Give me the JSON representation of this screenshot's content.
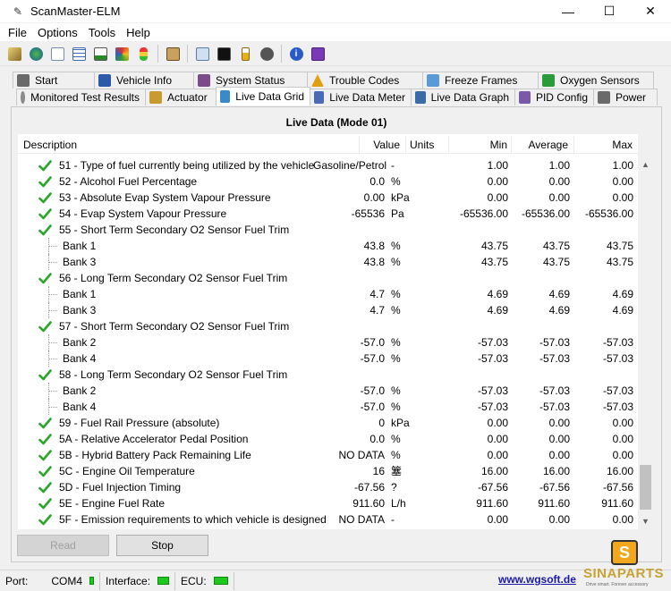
{
  "window": {
    "title": "ScanMaster-ELM",
    "controls": {
      "minimize": "—",
      "maximize": "☐",
      "close": "✕"
    }
  },
  "menu": [
    "File",
    "Options",
    "Tools",
    "Help"
  ],
  "toolbar_icons": [
    "connect-icon",
    "globe-icon",
    "document-icon",
    "grid-icon",
    "chart-icon",
    "gauge-icon",
    "stoplight-icon",
    "clipboard-icon",
    "terminal-chat-icon",
    "console-icon",
    "battery-icon",
    "stop-icon",
    "info-icon",
    "exit-icon"
  ],
  "tabs_row1": [
    {
      "label": "Start",
      "icon": "start-icon",
      "color": "#6a6a6a"
    },
    {
      "label": "Vehicle Info",
      "icon": "info-icon",
      "color": "#2d5aa8"
    },
    {
      "label": "System Status",
      "icon": "status-icon",
      "color": "#7a4a8a"
    },
    {
      "label": "Trouble Codes",
      "icon": "warning-icon",
      "color": "#e0a010"
    },
    {
      "label": "Freeze Frames",
      "icon": "snowflake-icon",
      "color": "#5a9ad8"
    },
    {
      "label": "Oxygen Sensors",
      "icon": "sensor-icon",
      "color": "#2a9a3a"
    }
  ],
  "tabs_row2": [
    {
      "label": "Monitored Test Results",
      "icon": "gear-icon",
      "color": "#8a8a8a"
    },
    {
      "label": "Actuator",
      "icon": "actuator-icon",
      "color": "#c89a30"
    },
    {
      "label": "Live Data Grid",
      "icon": "grid-icon",
      "color": "#3a8ac8",
      "active": true
    },
    {
      "label": "Live Data Meter",
      "icon": "meter-icon",
      "color": "#4a6ab8"
    },
    {
      "label": "Live Data Graph",
      "icon": "graph-icon",
      "color": "#3a6aa8"
    },
    {
      "label": "PID Config",
      "icon": "config-icon",
      "color": "#7a5aa8"
    },
    {
      "label": "Power",
      "icon": "power-icon",
      "color": "#6a6a6a"
    }
  ],
  "grid": {
    "title": "Live Data (Mode 01)",
    "columns": [
      "Description",
      "Value",
      "Units",
      "Min",
      "Average",
      "Max"
    ],
    "rows": [
      {
        "type": "pid",
        "desc": "51 - Type of fuel currently being utilized by the vehicle",
        "value": "Gasoline/Petrol",
        "units": "-",
        "min": "1.00",
        "avg": "1.00",
        "max": "1.00"
      },
      {
        "type": "pid",
        "desc": "52 - Alcohol Fuel Percentage",
        "value": "0.0",
        "units": "%",
        "min": "0.00",
        "avg": "0.00",
        "max": "0.00"
      },
      {
        "type": "pid",
        "desc": "53 - Absolute Evap System Vapour Pressure",
        "value": "0.00",
        "units": "kPa",
        "min": "0.00",
        "avg": "0.00",
        "max": "0.00"
      },
      {
        "type": "pid",
        "desc": "54 - Evap System Vapour Pressure",
        "value": "-65536",
        "units": "Pa",
        "min": "-65536.00",
        "avg": "-65536.00",
        "max": "-65536.00"
      },
      {
        "type": "pid",
        "desc": "55 - Short Term Secondary O2 Sensor Fuel Trim",
        "value": "",
        "units": "",
        "min": "",
        "avg": "",
        "max": ""
      },
      {
        "type": "sub",
        "desc": "Bank 1",
        "value": "43.8",
        "units": "%",
        "min": "43.75",
        "avg": "43.75",
        "max": "43.75"
      },
      {
        "type": "sub",
        "desc": "Bank 3",
        "value": "43.8",
        "units": "%",
        "min": "43.75",
        "avg": "43.75",
        "max": "43.75"
      },
      {
        "type": "pid",
        "desc": "56 - Long Term Secondary O2 Sensor Fuel Trim",
        "value": "",
        "units": "",
        "min": "",
        "avg": "",
        "max": ""
      },
      {
        "type": "sub",
        "desc": "Bank 1",
        "value": "4.7",
        "units": "%",
        "min": "4.69",
        "avg": "4.69",
        "max": "4.69"
      },
      {
        "type": "sub",
        "desc": "Bank 3",
        "value": "4.7",
        "units": "%",
        "min": "4.69",
        "avg": "4.69",
        "max": "4.69"
      },
      {
        "type": "pid",
        "desc": "57 - Short Term Secondary O2 Sensor Fuel Trim",
        "value": "",
        "units": "",
        "min": "",
        "avg": "",
        "max": ""
      },
      {
        "type": "sub",
        "desc": "Bank 2",
        "value": "-57.0",
        "units": "%",
        "min": "-57.03",
        "avg": "-57.03",
        "max": "-57.03"
      },
      {
        "type": "sub",
        "desc": "Bank 4",
        "value": "-57.0",
        "units": "%",
        "min": "-57.03",
        "avg": "-57.03",
        "max": "-57.03"
      },
      {
        "type": "pid",
        "desc": "58 - Long Term Secondary O2 Sensor Fuel Trim",
        "value": "",
        "units": "",
        "min": "",
        "avg": "",
        "max": ""
      },
      {
        "type": "sub",
        "desc": "Bank 2",
        "value": "-57.0",
        "units": "%",
        "min": "-57.03",
        "avg": "-57.03",
        "max": "-57.03"
      },
      {
        "type": "sub",
        "desc": "Bank 4",
        "value": "-57.0",
        "units": "%",
        "min": "-57.03",
        "avg": "-57.03",
        "max": "-57.03"
      },
      {
        "type": "pid",
        "desc": "59 - Fuel Rail Pressure (absolute)",
        "value": "0",
        "units": "kPa",
        "min": "0.00",
        "avg": "0.00",
        "max": "0.00"
      },
      {
        "type": "pid",
        "desc": "5A - Relative Accelerator Pedal Position",
        "value": "0.0",
        "units": "%",
        "min": "0.00",
        "avg": "0.00",
        "max": "0.00"
      },
      {
        "type": "pid",
        "desc": "5B - Hybrid Battery Pack Remaining Life",
        "value": "NO DATA",
        "units": "%",
        "min": "0.00",
        "avg": "0.00",
        "max": "0.00"
      },
      {
        "type": "pid",
        "desc": "5C - Engine Oil Temperature",
        "value": "16",
        "units": "簺",
        "min": "16.00",
        "avg": "16.00",
        "max": "16.00"
      },
      {
        "type": "pid",
        "desc": "5D - Fuel Injection Timing",
        "value": "-67.56",
        "units": "?",
        "min": "-67.56",
        "avg": "-67.56",
        "max": "-67.56"
      },
      {
        "type": "pid",
        "desc": "5E - Engine Fuel Rate",
        "value": "911.60",
        "units": "L/h",
        "min": "911.60",
        "avg": "911.60",
        "max": "911.60"
      },
      {
        "type": "pid",
        "desc": "5F - Emission requirements to which vehicle is designed",
        "value": "NO DATA",
        "units": "-",
        "min": "0.00",
        "avg": "0.00",
        "max": "0.00"
      }
    ]
  },
  "buttons": {
    "read": "Read",
    "stop": "Stop"
  },
  "status": {
    "port_label": "Port:",
    "port_value": "COM4",
    "interface_label": "Interface:",
    "ecu_label": "ECU:",
    "link": "www.wgsoft.de"
  },
  "logo": {
    "letter": "S",
    "text": "SINAPARTS",
    "tagline": "Drive smart. Forever accessory"
  },
  "colors": {
    "check_green": "#2aa52a",
    "led_green": "#1ec81e",
    "link_blue": "#1a1aa8"
  }
}
